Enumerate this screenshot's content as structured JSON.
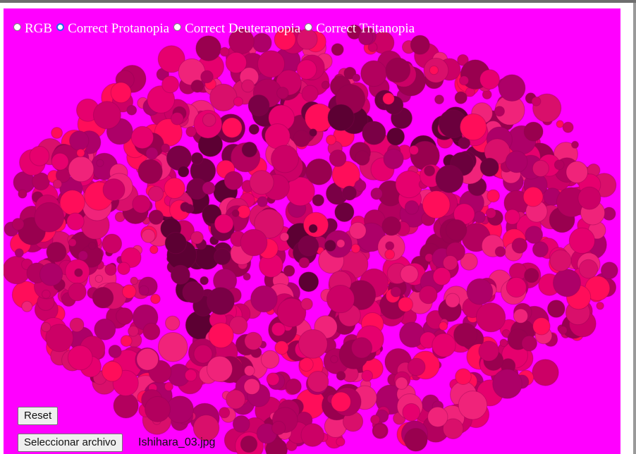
{
  "modes": [
    {
      "label": "RGB",
      "checked": false
    },
    {
      "label": "Correct Protanopia",
      "checked": true
    },
    {
      "label": "Correct Deuteranopia",
      "checked": false
    },
    {
      "label": "Correct Tritanopia",
      "checked": false
    }
  ],
  "controls": {
    "reset_label": "Reset",
    "choose_file_label": "Seleccionar archivo",
    "file_name": "Ishihara_03.jpg"
  },
  "colors": {
    "background": "#ff00ff",
    "dot_palette": [
      "#cc0066",
      "#e6006e",
      "#b3005e",
      "#ff0d5a",
      "#99004f",
      "#f0237a",
      "#ad0068",
      "#d90f6b"
    ],
    "figure_palette": [
      "#5c0033",
      "#6b003d",
      "#7a0046"
    ]
  }
}
